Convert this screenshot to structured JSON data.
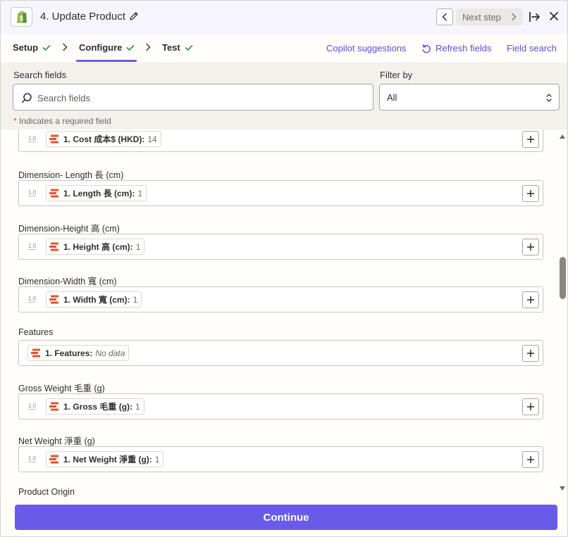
{
  "header": {
    "title": "4. Update Product",
    "app_icon": "shopify-bag-icon",
    "next_step_label": "Next step"
  },
  "tabs": [
    {
      "label": "Setup",
      "complete": true
    },
    {
      "label": "Configure",
      "complete": true,
      "active": true
    },
    {
      "label": "Test",
      "complete": true
    }
  ],
  "actions": {
    "copilot": "Copilot suggestions",
    "refresh": "Refresh fields",
    "field_search": "Field search"
  },
  "filters": {
    "search_label": "Search fields",
    "search_placeholder": "Search fields",
    "search_value": "",
    "filter_label": "Filter by",
    "filter_value": "All",
    "required_star": "*",
    "required_note": "Indicates a required field"
  },
  "fields": [
    {
      "label": "",
      "version": "1.0",
      "pill_name": "1. Cost 成本$ (HKD):",
      "pill_value": "14",
      "no_data": false
    },
    {
      "label": "Dimension- Length 長 (cm)",
      "version": "1.0",
      "pill_name": "1. Length 長 (cm):",
      "pill_value": "1",
      "no_data": false
    },
    {
      "label": "Dimension-Height 高 (cm)",
      "version": "1.0",
      "pill_name": "1. Height 高 (cm):",
      "pill_value": "1",
      "no_data": false
    },
    {
      "label": "Dimension-Width 寬 (cm)",
      "version": "1.0",
      "pill_name": "1. Width 寬 (cm):",
      "pill_value": "1",
      "no_data": false
    },
    {
      "label": "Features",
      "version": "",
      "pill_name": "1. Features:",
      "pill_value": "No data",
      "no_data": true
    },
    {
      "label": "Gross Weight 毛重 (g)",
      "version": "1.0",
      "pill_name": "1. Gross 毛重 (g):",
      "pill_value": "1",
      "no_data": false
    },
    {
      "label": "Net Weight 淨重 (g)",
      "version": "1.0",
      "pill_name": "1. Net Weight 淨重 (g):",
      "pill_value": "1",
      "no_data": false
    },
    {
      "label": "Product Origin",
      "version": "",
      "pill_name": "",
      "pill_value": "",
      "no_data": false
    }
  ],
  "footer": {
    "continue_label": "Continue"
  },
  "colors": {
    "accent": "#695be8",
    "step_icon": "#e0542e",
    "check": "#2f8f4e"
  }
}
